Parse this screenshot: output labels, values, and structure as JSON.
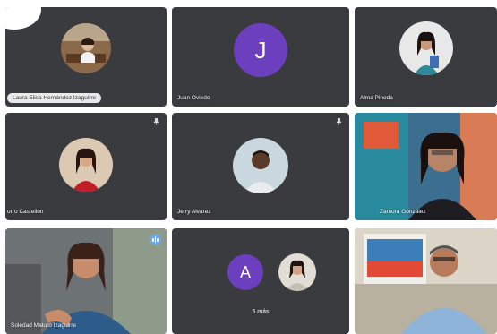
{
  "colors": {
    "tile_bg": "#3a3b3e",
    "avatar_purple": "#6c3fbf",
    "audio_badge": "#6ea8e8"
  },
  "tiles": [
    {
      "name": "Laura Elisa Hernández Izaguirre",
      "type": "photo-avatar"
    },
    {
      "name": "Juan Oviedo",
      "type": "letter-avatar",
      "letter": "J"
    },
    {
      "name": "Alma Pineda",
      "type": "photo-avatar"
    },
    {
      "name": "orro Castellón",
      "type": "photo-avatar"
    },
    {
      "name": "Jerry Alvarez",
      "type": "photo-avatar"
    },
    {
      "name": "Zamora González",
      "type": "video"
    },
    {
      "name": "Soledad Maturo Izaguirre",
      "type": "video"
    },
    {
      "type": "more",
      "letter": "A",
      "more_label": "5 más"
    },
    {
      "type": "video",
      "name": ""
    }
  ],
  "icons": {
    "pin": "pin-icon",
    "audio": "audio-level-icon"
  }
}
